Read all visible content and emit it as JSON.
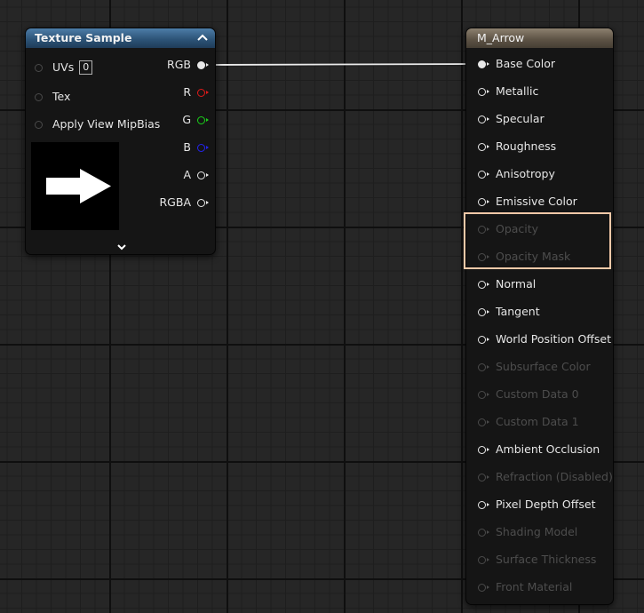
{
  "texture_node": {
    "title": "Texture Sample",
    "inputs": [
      {
        "label": "UVs",
        "value": "0"
      },
      {
        "label": "Tex"
      },
      {
        "label": "Apply View MipBias"
      }
    ],
    "outputs": [
      "RGB",
      "R",
      "G",
      "B",
      "A",
      "RGBA"
    ]
  },
  "material_node": {
    "title": "M_Arrow",
    "inputs": [
      {
        "label": "Base Color",
        "enabled": true
      },
      {
        "label": "Metallic",
        "enabled": true
      },
      {
        "label": "Specular",
        "enabled": true
      },
      {
        "label": "Roughness",
        "enabled": true
      },
      {
        "label": "Anisotropy",
        "enabled": true
      },
      {
        "label": "Emissive Color",
        "enabled": true
      },
      {
        "label": "Opacity",
        "enabled": false
      },
      {
        "label": "Opacity Mask",
        "enabled": false
      },
      {
        "label": "Normal",
        "enabled": true
      },
      {
        "label": "Tangent",
        "enabled": true
      },
      {
        "label": "World Position Offset",
        "enabled": true
      },
      {
        "label": "Subsurface Color",
        "enabled": false
      },
      {
        "label": "Custom Data 0",
        "enabled": false
      },
      {
        "label": "Custom Data 1",
        "enabled": false
      },
      {
        "label": "Ambient Occlusion",
        "enabled": true
      },
      {
        "label": "Refraction (Disabled)",
        "enabled": false
      },
      {
        "label": "Pixel Depth Offset",
        "enabled": true
      },
      {
        "label": "Shading Model",
        "enabled": false
      },
      {
        "label": "Surface Thickness",
        "enabled": false
      },
      {
        "label": "Front Material",
        "enabled": false
      }
    ]
  },
  "colors": {
    "highlight": "#f4c9a8",
    "texture_header": "#2d5478",
    "material_header": "#5e5446",
    "pin_r": "#e01a1a",
    "pin_g": "#1ad21a",
    "pin_b": "#2424f0"
  },
  "icons": {
    "collapse": "chevron-up-icon",
    "expand": "chevron-down-icon",
    "preview": "arrow-right-icon"
  }
}
